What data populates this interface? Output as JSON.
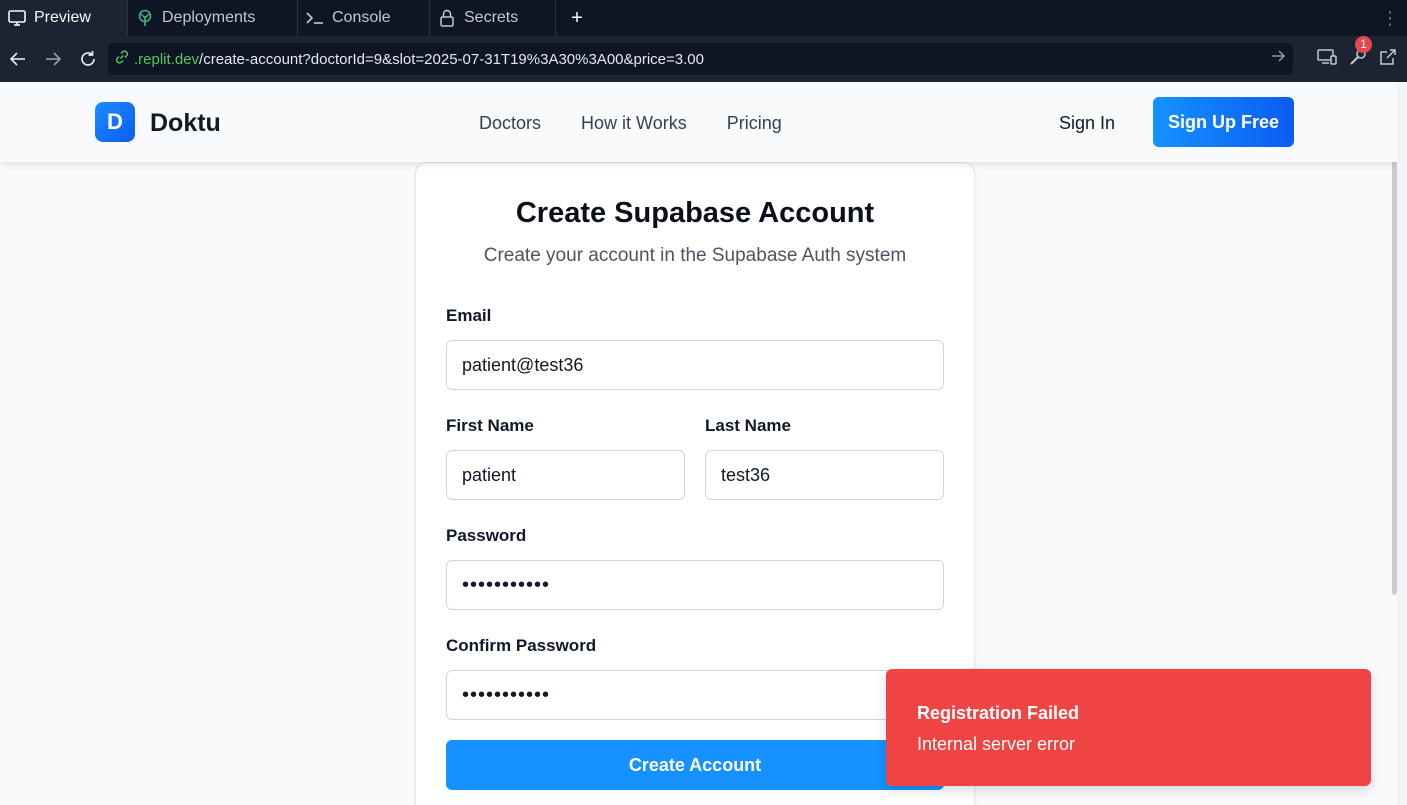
{
  "ide": {
    "tabs": [
      {
        "label": "Preview",
        "icon": "monitor-icon"
      },
      {
        "label": "Deployments",
        "icon": "deploy-icon"
      },
      {
        "label": "Console",
        "icon": "terminal-icon"
      },
      {
        "label": "Secrets",
        "icon": "lock-icon"
      }
    ],
    "add_tab": "+",
    "more": "⋮",
    "url_domain": ".replit.dev",
    "url_path": "/create-account?doctorId=9&slot=2025-07-31T19%3A30%3A00&price=3.00",
    "notification_count": "1"
  },
  "header": {
    "logo_letter": "D",
    "brand": "Doktu",
    "nav": [
      "Doctors",
      "How it Works",
      "Pricing"
    ],
    "sign_in": "Sign In",
    "sign_up": "Sign Up Free"
  },
  "form": {
    "title": "Create Supabase Account",
    "subtitle": "Create your account in the Supabase Auth system",
    "email_label": "Email",
    "email_value": "patient@test36",
    "first_name_label": "First Name",
    "first_name_value": "patient",
    "last_name_label": "Last Name",
    "last_name_value": "test36",
    "password_label": "Password",
    "password_value": "•••••••••••",
    "confirm_label": "Confirm Password",
    "confirm_value": "•••••••••••",
    "submit_label": "Create Account"
  },
  "toast": {
    "title": "Registration Failed",
    "message": "Internal server error"
  },
  "colors": {
    "primary": "#1592ff",
    "error": "#ef4444",
    "ide_bg": "#0e1525"
  }
}
